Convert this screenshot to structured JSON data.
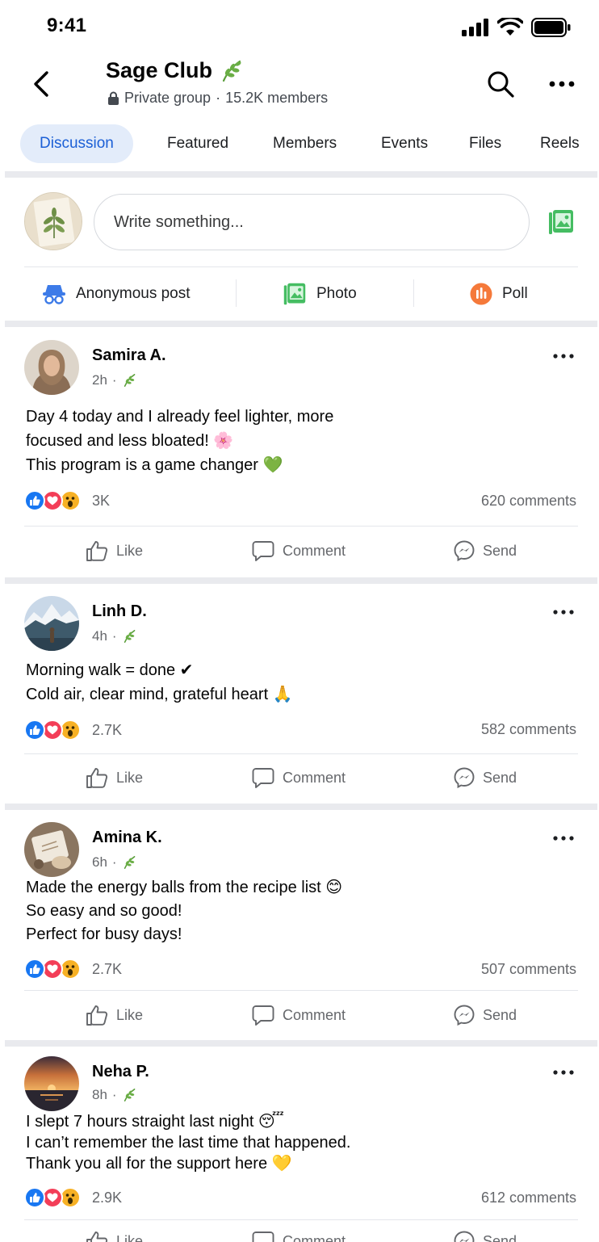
{
  "status_bar": {
    "time": "9:41"
  },
  "header": {
    "title": "Sage Club",
    "privacy": "Private group",
    "separator": "·",
    "members": "15.2K members"
  },
  "tabs": [
    {
      "label": "Discussion",
      "active": true
    },
    {
      "label": "Featured"
    },
    {
      "label": "Members"
    },
    {
      "label": "Events"
    },
    {
      "label": "Files"
    },
    {
      "label": "Reels"
    }
  ],
  "composer": {
    "placeholder": "Write something...",
    "actions": [
      {
        "label": "Anonymous post",
        "icon": "anonymous-icon"
      },
      {
        "label": "Photo",
        "icon": "photo-icon"
      },
      {
        "label": "Poll",
        "icon": "poll-icon"
      }
    ]
  },
  "post_actions": {
    "like": "Like",
    "comment": "Comment",
    "send": "Send"
  },
  "colors": {
    "accent": "#1b5fd6",
    "tab_active_bg": "#e3ecfa",
    "green": "#42b72a",
    "like_blue": "#1877f2",
    "love_red": "#f33e58",
    "wow_yellow": "#f7b125",
    "poll_orange": "#f5793a"
  },
  "posts": [
    {
      "author": "Samira A.",
      "time": "2h",
      "lines": [
        "Day 4 today and I already feel lighter, more",
        "focused and less bloated! 🌸",
        "This program is a game changer 💚"
      ],
      "reactions": "3K",
      "comments": "620 comments"
    },
    {
      "author": "Linh D.",
      "time": "4h",
      "lines": [
        "Morning walk = done ✔",
        "Cold air, clear mind, grateful heart 🙏"
      ],
      "reactions": "2.7K",
      "comments": "582 comments"
    },
    {
      "author": "Amina K.",
      "time": "6h",
      "lines": [
        "Made the energy balls from the recipe list 😊",
        "So easy and so good!",
        "Perfect for busy days!"
      ],
      "reactions": "2.7K",
      "comments": "507 comments"
    },
    {
      "author": "Neha P.",
      "time": "8h",
      "lines": [
        "I slept 7 hours straight last night 😴",
        "I can’t remember the last time that happened.",
        "Thank you all for the support here 💛"
      ],
      "reactions": "2.9K",
      "comments": "612 comments"
    }
  ]
}
